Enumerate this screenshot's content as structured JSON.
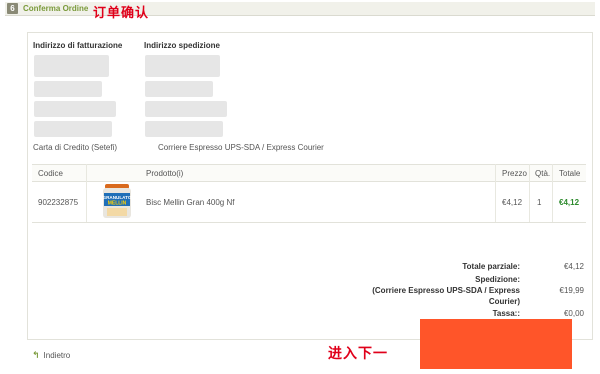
{
  "step": {
    "number": "6",
    "title": "Conferma Ordine"
  },
  "annotations": {
    "top": "订单确认",
    "bottom": "进入下一"
  },
  "billing": {
    "heading": "Indirizzo di fatturazione",
    "payment": "Carta di Credito (Setefi)"
  },
  "shipping": {
    "heading": "Indirizzo spedizione",
    "method": "Corriere Espresso UPS-SDA / Express Courier"
  },
  "table": {
    "headers": {
      "code": "Codice",
      "product": "Prodotto(i)",
      "price": "Prezzo",
      "qty": "Qtà.",
      "total": "Totale"
    },
    "rows": [
      {
        "code": "902232875",
        "name": "Bisc Mellin Gran 400g Nf",
        "price": "€4,12",
        "qty": "1",
        "total": "€4,12",
        "image_text": "GRANULATO MELLIN"
      }
    ]
  },
  "summary": {
    "subtotal_label": "Totale parziale:",
    "subtotal_value": "€4,12",
    "shipping_label_1": "Spedizione:",
    "shipping_label_2": "(Corriere Espresso UPS-SDA / Express",
    "shipping_label_3": "Courier)",
    "shipping_value": "€19,99",
    "tax_label": "Tassa::",
    "tax_value": "€0,00"
  },
  "footer": {
    "back_label": "Indietro"
  },
  "colors": {
    "accent_green": "#7a9a3a",
    "total_green": "#2e8b2e",
    "next_block": "#ff5529",
    "annotation_red": "#e0001a"
  },
  "icons": {
    "back": "back-arrow-icon"
  }
}
